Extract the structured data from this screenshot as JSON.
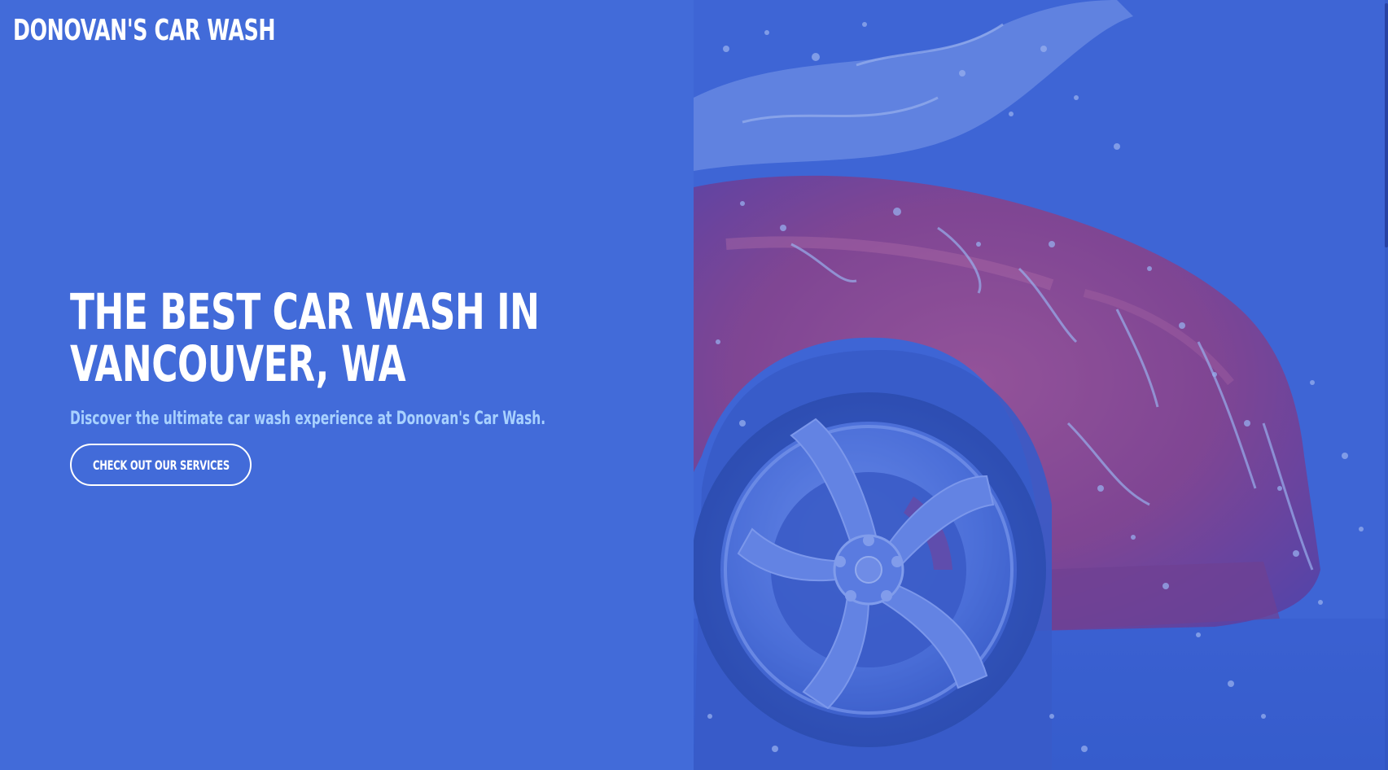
{
  "header": {
    "logo_text": "DONOVAN'S CAR WASH"
  },
  "hero": {
    "title": "THE BEST CAR WASH IN VANCOUVER, WA",
    "subtitle": "Discover the ultimate car wash experience at Donovan's Car Wash.",
    "cta_label": "CHECK OUT OUR SERVICES"
  },
  "media": {
    "image_subject": "red car wheel splashed with water under blue overlay"
  },
  "colors": {
    "background": "#426bd9",
    "subtitle": "#a8d1ff",
    "text": "#ffffff",
    "overlay": "#3d63d3",
    "car_body": "#c0305a"
  }
}
